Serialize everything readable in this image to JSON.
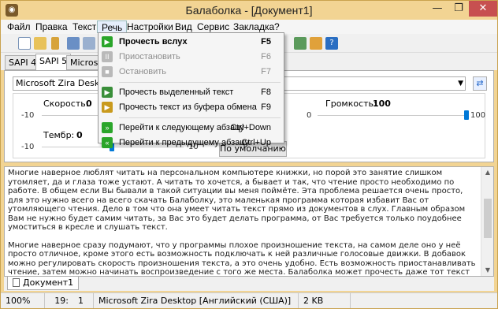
{
  "window": {
    "title": "Балаболка - [Документ1]",
    "app_icon": "owl-icon",
    "controls": {
      "minimize": "—",
      "maximize": "❐",
      "close": "✕"
    }
  },
  "menubar": [
    "Файл",
    "Правка",
    "Текст",
    "Речь",
    "Настройки",
    "Вид",
    "Сервис",
    "Закладка",
    "?"
  ],
  "open_menu_index": 3,
  "speech_menu": [
    {
      "label": "Прочесть вслух",
      "shortcut": "F5",
      "icon": "play-icon",
      "color": "#2aa52a",
      "enabled": true,
      "bold": true
    },
    {
      "label": "Приостановить",
      "shortcut": "F6",
      "icon": "pause-icon",
      "color": "#b9b9b9",
      "enabled": false
    },
    {
      "label": "Остановить",
      "shortcut": "F7",
      "icon": "stop-icon",
      "color": "#b9b9b9",
      "enabled": false
    },
    {
      "separator": true
    },
    {
      "label": "Прочесть выделенный текст",
      "shortcut": "F8",
      "icon": "read-selection-icon",
      "color": "#3a8f3a",
      "enabled": true
    },
    {
      "label": "Прочесть текст из буфера обмена",
      "shortcut": "F9",
      "icon": "clipboard-read-icon",
      "color": "#c99a1d",
      "enabled": true
    },
    {
      "separator": true
    },
    {
      "label": "Перейти к следующему абзацу",
      "shortcut": "Ctrl+Down",
      "icon": "next-paragraph-icon",
      "color": "#2aa52a",
      "enabled": true
    },
    {
      "label": "Перейти к предыдущему абзацу",
      "shortcut": "Ctrl+Up",
      "icon": "prev-paragraph-icon",
      "color": "#2aa52a",
      "enabled": true
    }
  ],
  "tabs": [
    "SAPI 4",
    "SAPI 5",
    "Microsoft"
  ],
  "active_tab_index": 1,
  "voice": {
    "selected": "Microsoft Zira Desktop [Английский (США)]",
    "dropdown_icon": "▼",
    "refresh_icon": "⇄"
  },
  "sliders": {
    "speed": {
      "label": "Скорость:",
      "value": "0",
      "min": "-10",
      "max": "10",
      "level": 0
    },
    "volume": {
      "label": "Громкость:",
      "value": "100",
      "min": "0",
      "max": "100",
      "level": 100
    },
    "pitch": {
      "label": "Тембр:",
      "value": "0",
      "min": "-10",
      "max": "10",
      "level": 0
    }
  },
  "default_button": "По умолчанию",
  "text_paragraphs": [
    "Многие наверное люблят читать на персональном компьютере книжки, но порой это занятие слишком утомляет, да и глаза тоже устают. А читать то хочется, а бывает и так, что чтение просто необходимо по работе. В общем если Вы бывали в такой ситуации вы меня поймёте. Эта проблема решается очень просто, для это нужно всего на всего скачать Балаболку, это маленькая программа которая избавит Вас от утомляющего чтения. Дело в том что она умеет читать текст прямо из документов в слух. Главным образом Вам не нужно будет самим читать, за Вас это будет делать программа, от Вас требуется только поудобнее умоститься в кресле и слушать текст.",
    "Многие наверное сразу подумают, что у программы плохое произношение текста, на самом деле оно у неё просто отличное, кроме этого есть возможность подключать к ней различные голосовые движки. В добавок можно регулировать скорость произношения текста, а это очень удобно. Есть возможность приостанавливать чтение, затем можно начинать воспроизведение с того же места. Балаболка может прочесть даже тот текст который находится в буфере обмена системы. Ещё она умеет проговарить текст который Вы набираете на клавиатуре компьютера."
  ],
  "document_tab": "Документ1",
  "status": {
    "zoom": "100%",
    "line": "19:",
    "col": "1",
    "voice": "Microsoft Zira Desktop [Английский (США)]",
    "size": "2 KB"
  },
  "colors": {
    "title_bg": "#f2d493",
    "accent": "#0078d7",
    "close_bg": "#c75050"
  }
}
